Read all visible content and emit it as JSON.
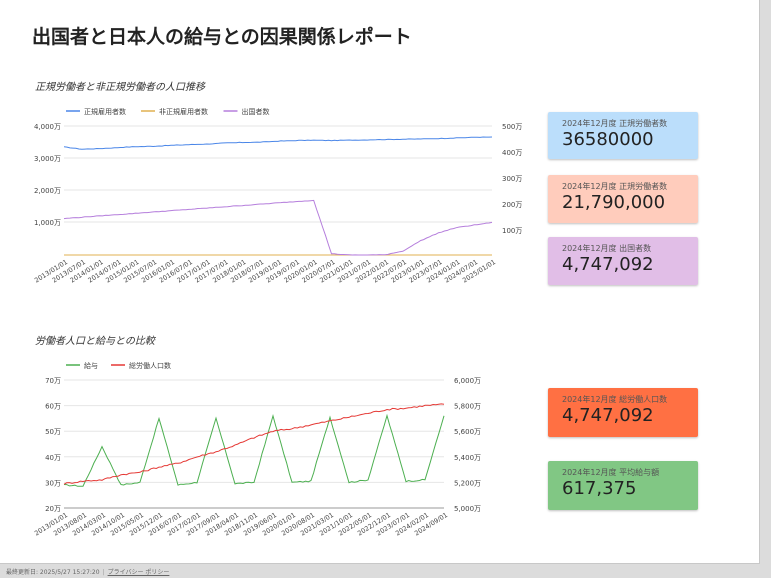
{
  "report": {
    "title": "出国者と日本人の給与との因果関係レポート"
  },
  "chart1_section": {
    "title": "正規労働者と非正規労働者の人口推移"
  },
  "chart2_section": {
    "title": "労働者人口と給与との比較"
  },
  "chart_data": [
    {
      "type": "line",
      "title": "正規労働者と非正規労働者の人口推移",
      "x": [
        "2013/01/01",
        "2013/07/01",
        "2014/01/01",
        "2014/07/01",
        "2015/01/01",
        "2015/07/01",
        "2016/01/01",
        "2016/07/01",
        "2017/01/01",
        "2017/07/01",
        "2018/01/01",
        "2018/07/01",
        "2019/01/01",
        "2019/07/01",
        "2020/01/01",
        "2020/07/01",
        "2021/01/01",
        "2021/07/01",
        "2022/01/01",
        "2022/07/01",
        "2023/01/01",
        "2023/07/01",
        "2024/01/01",
        "2024/07/01",
        "2025/01/01"
      ],
      "y_left": {
        "ticks": [
          "4,000万",
          "3,000万",
          "2,000万",
          "1,000万"
        ],
        "ylim": [
          0,
          40000000
        ]
      },
      "y_right": {
        "ticks": [
          "500万",
          "400万",
          "300万",
          "200万",
          "100万"
        ],
        "ylim": [
          50000,
          5000000
        ]
      },
      "grid": true,
      "legend_position": "top-left",
      "series": [
        {
          "name": "正規雇用者数",
          "axis": "left",
          "color": "#4a86e8",
          "values": [
            33500000,
            32800000,
            33000000,
            33300000,
            33600000,
            33700000,
            34000000,
            34200000,
            34400000,
            34700000,
            34900000,
            35000000,
            35300000,
            35500000,
            35600000,
            35500000,
            35600000,
            35700000,
            35800000,
            35900000,
            36000000,
            36100000,
            36300000,
            36500000,
            36580000
          ]
        },
        {
          "name": "非正規雇用者数",
          "axis": "left",
          "color": "#e0b050",
          "values": [
            0,
            0,
            0,
            0,
            0,
            0,
            0,
            0,
            0,
            0,
            0,
            0,
            0,
            0,
            0,
            0,
            0,
            0,
            0,
            0,
            0,
            0,
            0,
            0,
            0
          ]
        },
        {
          "name": "出国者数",
          "axis": "right",
          "color": "#b57edc",
          "values": [
            1450000,
            1500000,
            1550000,
            1600000,
            1650000,
            1700000,
            1750000,
            1800000,
            1850000,
            1900000,
            1950000,
            2000000,
            2050000,
            2100000,
            2150000,
            100000,
            50000,
            50000,
            60000,
            200000,
            600000,
            900000,
            1100000,
            1200000,
            1300000
          ]
        }
      ]
    },
    {
      "type": "line",
      "title": "労働者人口と給与との比較",
      "x": [
        "2013/01/01",
        "2013/08/01",
        "2014/03/01",
        "2014/10/01",
        "2015/05/01",
        "2015/12/01",
        "2016/07/01",
        "2017/02/01",
        "2017/09/01",
        "2018/04/01",
        "2018/11/01",
        "2019/06/01",
        "2020/01/01",
        "2020/08/01",
        "2021/03/01",
        "2021/10/01",
        "2022/05/01",
        "2022/12/01",
        "2023/07/01",
        "2024/02/01",
        "2024/09/01"
      ],
      "y_left": {
        "ticks": [
          "70万",
          "60万",
          "50万",
          "40万",
          "30万",
          "20万"
        ],
        "ylim": [
          200000,
          700000
        ]
      },
      "y_right": {
        "ticks": [
          "6,000万",
          "5,800万",
          "5,600万",
          "5,400万",
          "5,200万",
          "5,000万"
        ],
        "ylim": [
          50000000,
          60000000
        ]
      },
      "grid": true,
      "legend_position": "top-left",
      "series": [
        {
          "name": "給与",
          "axis": "left",
          "color": "#4caf50",
          "values": [
            290000,
            285000,
            440000,
            290000,
            300000,
            550000,
            290000,
            300000,
            550000,
            295000,
            300000,
            560000,
            300000,
            305000,
            555000,
            300000,
            310000,
            560000,
            305000,
            310000,
            560000
          ]
        },
        {
          "name": "総労働人口数",
          "axis": "right",
          "color": "#e53935",
          "values": [
            51900000,
            52100000,
            52200000,
            52600000,
            52800000,
            53200000,
            53500000,
            54000000,
            54400000,
            54900000,
            55500000,
            56000000,
            56200000,
            56500000,
            56800000,
            57100000,
            57400000,
            57700000,
            57800000,
            58000000,
            58100000
          ]
        }
      ]
    }
  ],
  "cards": [
    {
      "label": "2024年12月度 正規労働者数",
      "value": "36580000",
      "color": "#bbdefb"
    },
    {
      "label": "2024年12月度 正規労働者数",
      "value": "21,790,000",
      "color": "#ffccbc"
    },
    {
      "label": "2024年12月度 出国者数",
      "value": "4,747,092",
      "color": "#e1bee7"
    },
    {
      "label": "2024年12月度 総労働人口数",
      "value": "4,747,092",
      "color": "#ff7043"
    },
    {
      "label": "2024年12月度 平均給与額",
      "value": "617,375",
      "color": "#81c784"
    }
  ],
  "footer": {
    "updated": "最終更新日: 2025/5/27 15:27:20",
    "privacy_link": "プライバシー ポリシー"
  }
}
